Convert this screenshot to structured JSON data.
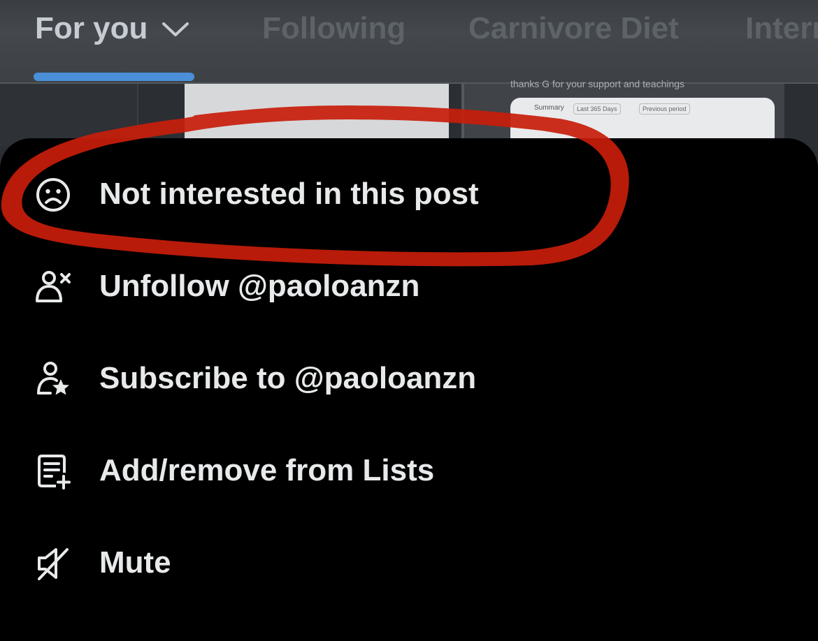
{
  "tabs": [
    {
      "label": "For you",
      "active": true
    },
    {
      "label": "Following",
      "active": false
    },
    {
      "label": "Carnivore Diet",
      "active": false
    },
    {
      "label": "Interr",
      "active": false
    }
  ],
  "feed": {
    "caption": "thanks G for your support and teachings",
    "card_labels": [
      "Summary",
      "Last 365 Days",
      "Previous period"
    ]
  },
  "menu": [
    {
      "label": "Not interested in this post",
      "icon": "frown-face-icon"
    },
    {
      "label": "Unfollow @paoloanzn",
      "icon": "person-x-icon"
    },
    {
      "label": "Subscribe to @paoloanzn",
      "icon": "person-star-icon"
    },
    {
      "label": "Add/remove from Lists",
      "icon": "list-add-icon"
    },
    {
      "label": "Mute",
      "icon": "mute-speaker-icon"
    }
  ],
  "colors": {
    "sheet_background": "#000000",
    "menu_text": "#e7e9ea",
    "tab_underline": "#4a8fd8",
    "annotation_scribble": "#c81e0a"
  }
}
